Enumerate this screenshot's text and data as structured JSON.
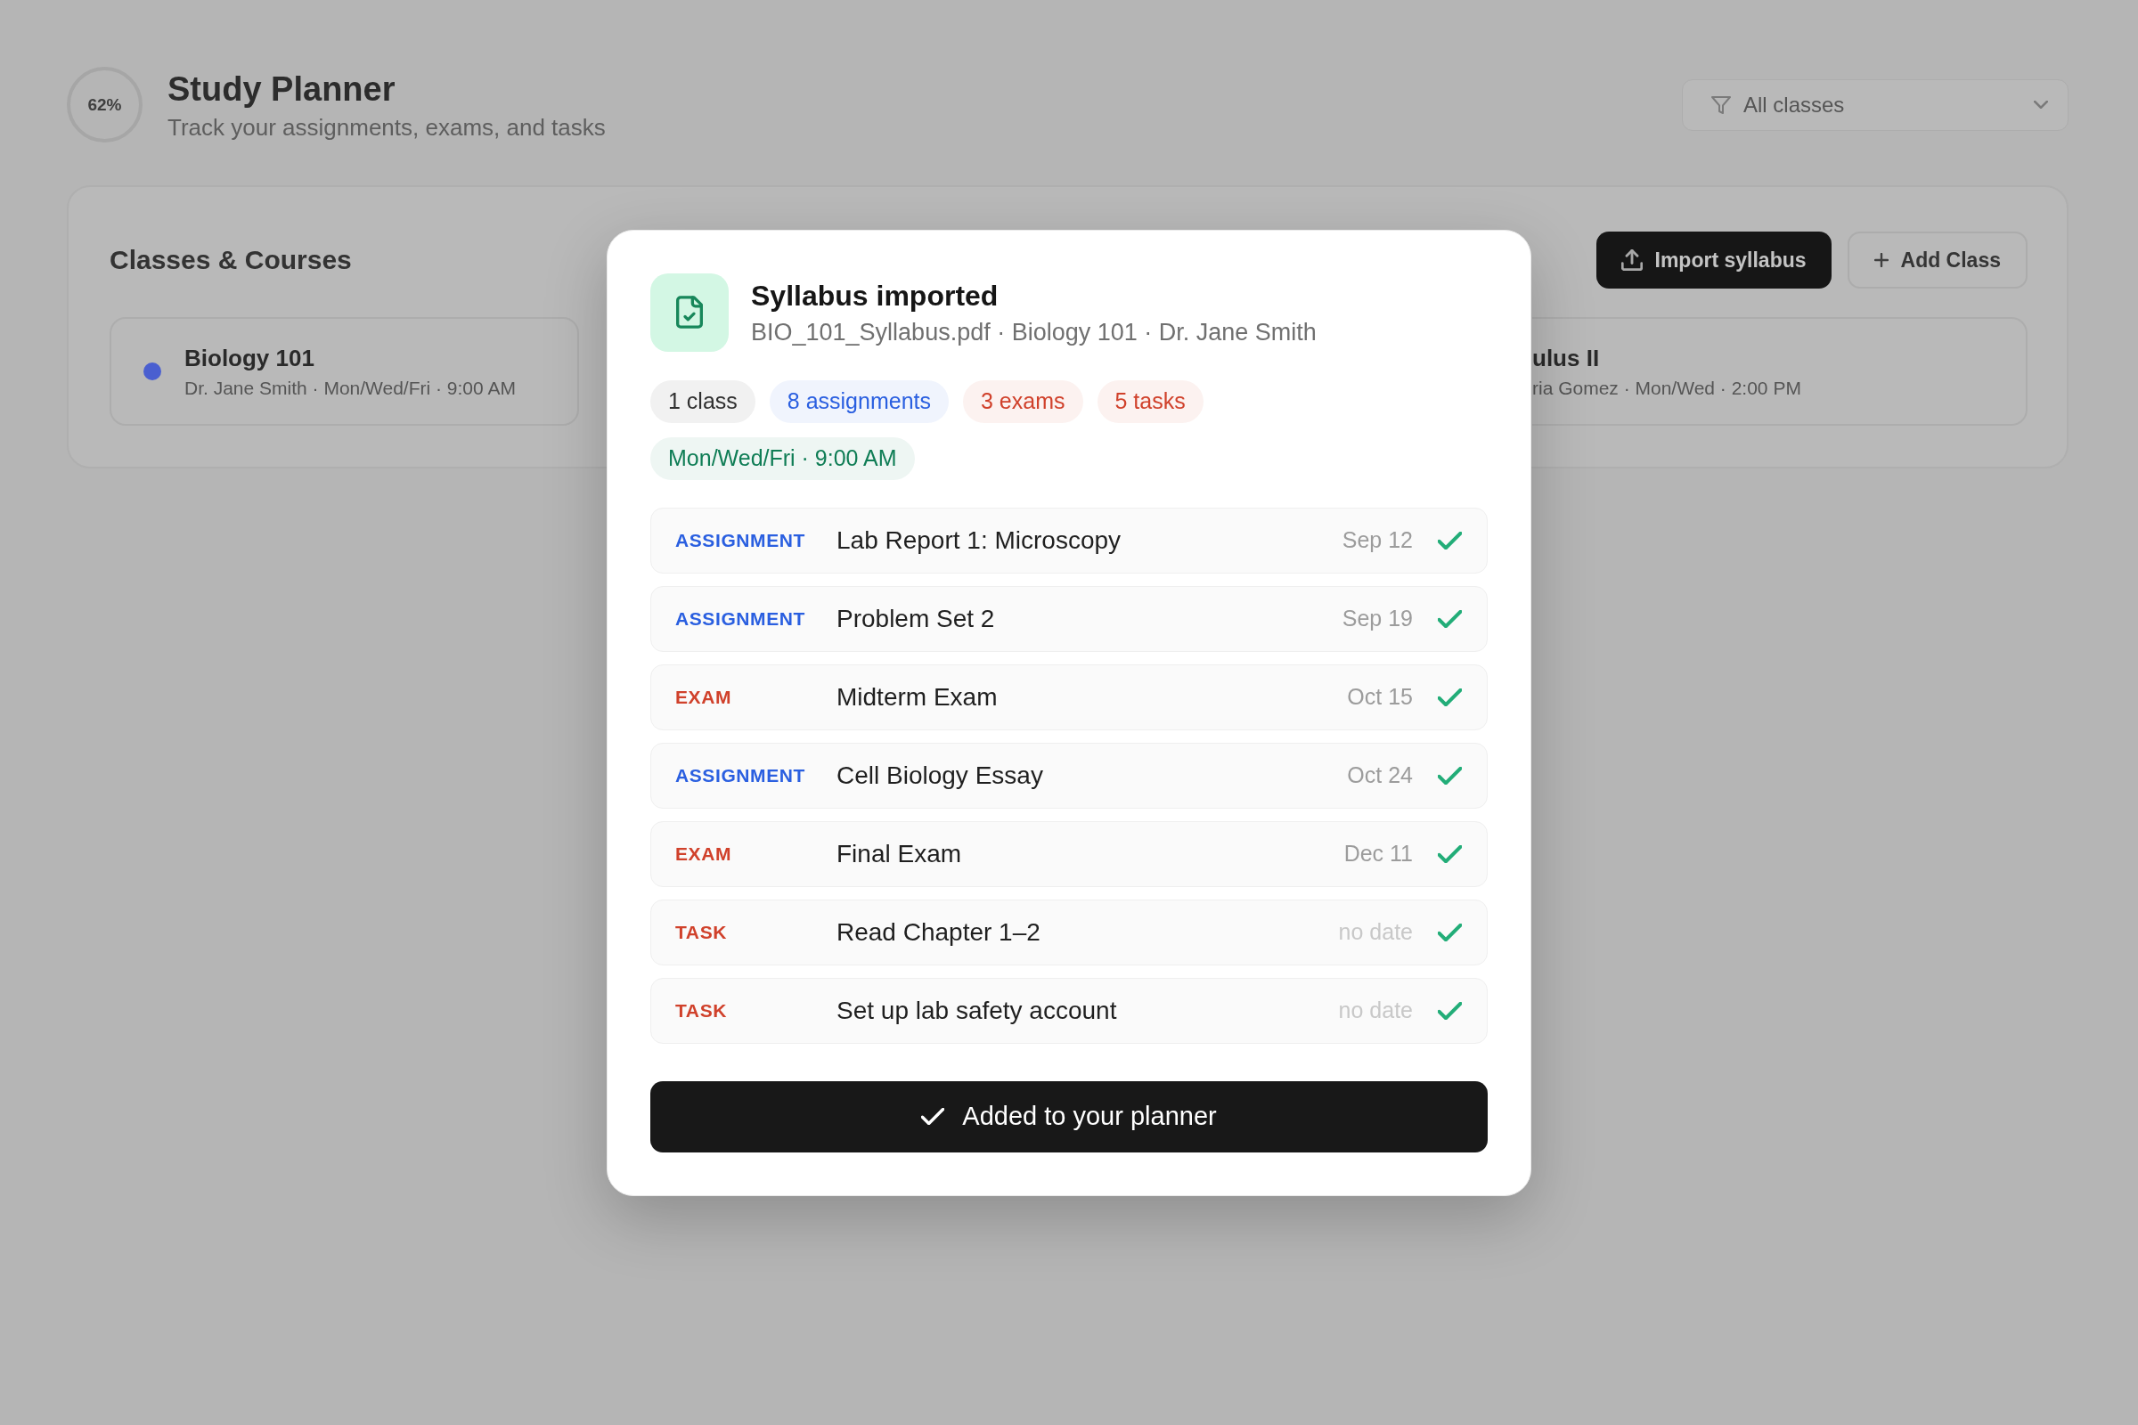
{
  "background": {
    "progress_ring": {
      "label": "62%"
    },
    "title": "Study Planner",
    "subtitle": "Track your assignments, exams, and tasks",
    "class_filter": {
      "value": "All classes"
    },
    "classes_panel": {
      "title": "Classes & Courses",
      "buttons": [
        {
          "label": "Import syllabus",
          "kind": "primary"
        },
        {
          "label": "Add Class",
          "kind": "secondary"
        }
      ],
      "classes": [
        {
          "name": "Biology 101",
          "details": "Dr. Jane Smith · Mon/Wed/Fri · 9:00 AM",
          "color": "#4a5fd0"
        },
        {
          "name": "ulus II",
          "details": "ria Gomez · Mon/Wed · 2:00 PM"
        }
      ]
    }
  },
  "dialog": {
    "title": "Syllabus imported",
    "subtitle": "BIO_101_Syllabus.pdf · Biology 101 · Dr. Jane Smith",
    "chips": [
      {
        "label": "1 class",
        "color": "#303030"
      },
      {
        "label": "8 assignments",
        "color": "#2a5fe0"
      },
      {
        "label": "3 exams",
        "color": "#d0412b"
      },
      {
        "label": "5 tasks",
        "color": "#d0412b"
      }
    ],
    "schedule": {
      "label": "Mon/Wed/Fri · 9:00 AM",
      "color": "#0f7d55"
    },
    "items": [
      {
        "kind": "assignment",
        "type": "ASSIGNMENT",
        "title": "Lab Report 1: Microscopy",
        "date": "Sep 12",
        "dated": true,
        "added": true
      },
      {
        "kind": "assignment",
        "type": "ASSIGNMENT",
        "title": "Problem Set 2",
        "date": "Sep 19",
        "dated": true,
        "added": true
      },
      {
        "kind": "exam",
        "type": "EXAM",
        "title": "Midterm Exam",
        "date": "Oct 15",
        "dated": true,
        "added": true
      },
      {
        "kind": "assignment",
        "type": "ASSIGNMENT",
        "title": "Cell Biology Essay",
        "date": "Oct 24",
        "dated": true,
        "added": true
      },
      {
        "kind": "exam",
        "type": "EXAM",
        "title": "Final Exam",
        "date": "Dec 11",
        "dated": true,
        "added": true
      },
      {
        "kind": "task",
        "type": "TASK",
        "title": "Read Chapter 1–2",
        "date": "no date",
        "dated": false,
        "added": true
      },
      {
        "kind": "task",
        "type": "TASK",
        "title": "Set up lab safety account",
        "date": "no date",
        "dated": false,
        "added": true
      }
    ],
    "button": {
      "label": "Added to your planner"
    }
  }
}
